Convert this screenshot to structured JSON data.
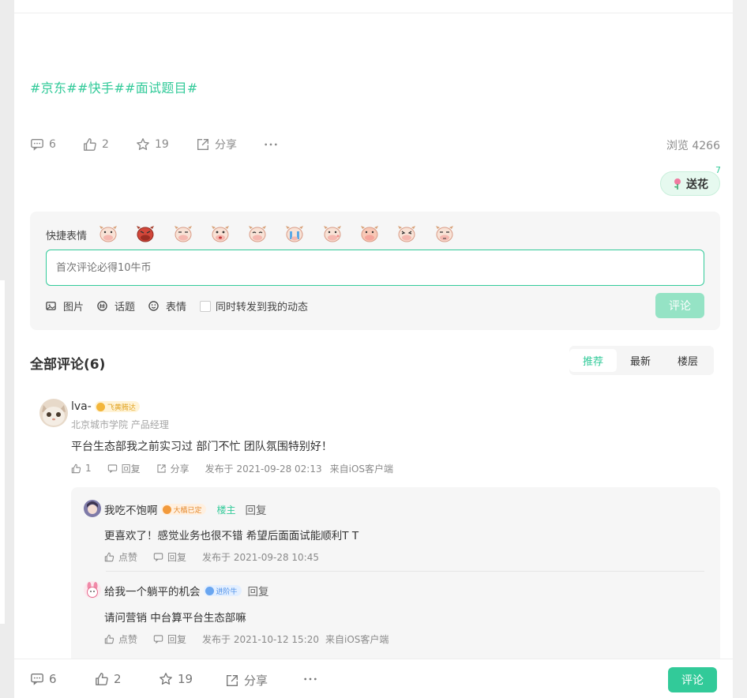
{
  "post": {
    "tags": "#京东##快手##面试题目#",
    "stats": {
      "comments": "6",
      "likes": "2",
      "favorites": "19",
      "share_label": "分享",
      "views": "浏览 4266"
    },
    "flower": {
      "label": "送花",
      "count": "7"
    }
  },
  "compose": {
    "quick_emoji_label": "快捷表情",
    "placeholder": "首次评论必得10牛币",
    "tools": {
      "image": "图片",
      "topic": "话题",
      "emoji": "表情",
      "repost": "同时转发到我的动态"
    },
    "submit_label": "评论"
  },
  "comments": {
    "title": "全部评论(6)",
    "sort_tabs": [
      "推荐",
      "最新",
      "楼层"
    ],
    "active_sort": "推荐"
  },
  "comment1": {
    "username": "lva-",
    "badge": "飞黄腾达",
    "school": "北京城市学院 产品经理",
    "text": "平台生态部我之前实习过 部门不忙 团队氛围特别好！",
    "likes": "1",
    "reply_label": "回复",
    "share_label": "分享",
    "time": "发布于 2021-09-28 02:13",
    "source": "来自iOS客户端"
  },
  "reply1": {
    "username": "我吃不饱啊",
    "badge": "大橘已定",
    "owner_tag": "楼主",
    "reply_label": "回复",
    "text": "更喜欢了！感觉业务也很不错 希望后面面试能顺利T T",
    "like_label": "点赞",
    "time": "发布于 2021-09-28 10:45"
  },
  "reply2": {
    "username": "给我一个躺平的机会",
    "badge": "进阶牛",
    "reply_label": "回复",
    "text": "请问营销 中台算平台生态部嘛",
    "like_label": "点赞",
    "time": "发布于 2021-10-12 15:20",
    "source": "来自iOS客户端"
  },
  "bottom": {
    "comments": "6",
    "likes": "2",
    "favorites": "19",
    "share_label": "分享",
    "submit_label": "评论"
  },
  "colors": {
    "accent": "#32ca99",
    "accent_light": "#95e3c5",
    "text": "#333333",
    "muted": "#8a8a8a"
  }
}
